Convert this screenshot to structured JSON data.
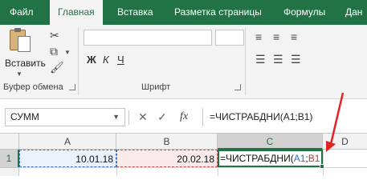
{
  "ribbon_tabs": [
    {
      "label": "Файл",
      "active": false
    },
    {
      "label": "Главная",
      "active": true
    },
    {
      "label": "Вставка",
      "active": false
    },
    {
      "label": "Разметка страницы",
      "active": false
    },
    {
      "label": "Формулы",
      "active": false
    },
    {
      "label": "Дан",
      "active": false
    }
  ],
  "clipboard_group": {
    "paste_label": "Вставить",
    "group_label": "Буфер обмена"
  },
  "font_group": {
    "group_label": "Шрифт"
  },
  "formula_bar": {
    "name_box": "СУММ",
    "fx_label": "fx",
    "formula": "=ЧИСТРАБДНИ(A1;B1)"
  },
  "grid": {
    "columns": [
      "A",
      "B",
      "C",
      "D"
    ],
    "active_column": "C",
    "row_number": "1",
    "cells": {
      "A1": "10.01.18",
      "B1": "20.02.18",
      "C1_prefix": "=ЧИСТРАБДНИ(",
      "C1_ref_a": "A1",
      "C1_sep": ";",
      "C1_ref_b": "B1"
    }
  },
  "colors": {
    "excel_green": "#217346",
    "ref_a_blue": "#2f6ebf",
    "ref_b_red": "#c0392b",
    "annotation_arrow": "#e32222"
  }
}
